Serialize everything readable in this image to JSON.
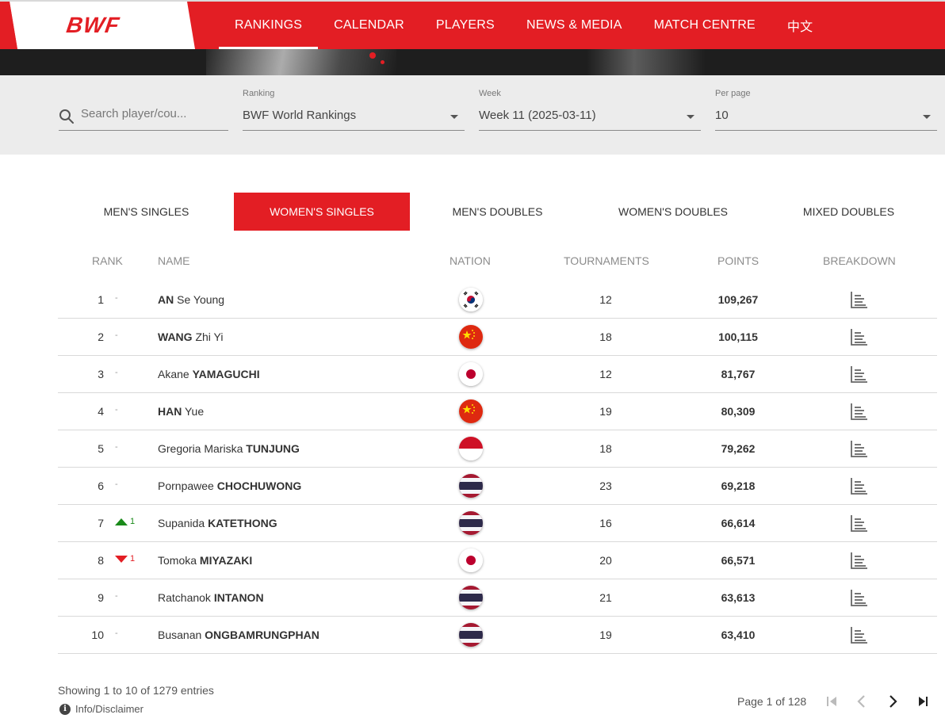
{
  "header": {
    "logo": "BWF",
    "nav": [
      {
        "label": "RANKINGS",
        "active": true
      },
      {
        "label": "CALENDAR",
        "active": false
      },
      {
        "label": "PLAYERS",
        "active": false
      },
      {
        "label": "NEWS & MEDIA",
        "active": false
      },
      {
        "label": "MATCH CENTRE",
        "active": false
      },
      {
        "label": "中文",
        "active": false
      }
    ]
  },
  "filters": {
    "search": {
      "placeholder": "Search player/cou..."
    },
    "ranking": {
      "label": "Ranking",
      "value": "BWF World Rankings"
    },
    "week": {
      "label": "Week",
      "value": "Week 11 (2025-03-11)"
    },
    "per_page": {
      "label": "Per page",
      "value": "10"
    }
  },
  "tabs": [
    {
      "label": "MEN'S SINGLES",
      "active": false
    },
    {
      "label": "WOMEN'S SINGLES",
      "active": true
    },
    {
      "label": "MEN'S DOUBLES",
      "active": false
    },
    {
      "label": "WOMEN'S DOUBLES",
      "active": false
    },
    {
      "label": "MIXED DOUBLES",
      "active": false
    }
  ],
  "table": {
    "headers": {
      "rank": "RANK",
      "name": "NAME",
      "nation": "NATION",
      "tournaments": "TOURNAMENTS",
      "points": "POINTS",
      "breakdown": "BREAKDOWN"
    },
    "rows": [
      {
        "rank": "1",
        "change": "-",
        "trend": "none",
        "first": "",
        "bold": "AN",
        "last": " Se Young",
        "nation": "KOR",
        "tournaments": "12",
        "points": "109,267"
      },
      {
        "rank": "2",
        "change": "-",
        "trend": "none",
        "first": "",
        "bold": "WANG",
        "last": " Zhi Yi",
        "nation": "CHN",
        "tournaments": "18",
        "points": "100,115"
      },
      {
        "rank": "3",
        "change": "-",
        "trend": "none",
        "first": "Akane ",
        "bold": "YAMAGUCHI",
        "last": "",
        "nation": "JPN",
        "tournaments": "12",
        "points": "81,767"
      },
      {
        "rank": "4",
        "change": "-",
        "trend": "none",
        "first": "",
        "bold": "HAN",
        "last": " Yue",
        "nation": "CHN",
        "tournaments": "19",
        "points": "80,309"
      },
      {
        "rank": "5",
        "change": "-",
        "trend": "none",
        "first": "Gregoria Mariska ",
        "bold": "TUNJUNG",
        "last": "",
        "nation": "INA",
        "tournaments": "18",
        "points": "79,262"
      },
      {
        "rank": "6",
        "change": "-",
        "trend": "none",
        "first": "Pornpawee ",
        "bold": "CHOCHUWONG",
        "last": "",
        "nation": "THA",
        "tournaments": "23",
        "points": "69,218"
      },
      {
        "rank": "7",
        "change": "1",
        "trend": "up",
        "first": "Supanida ",
        "bold": "KATETHONG",
        "last": "",
        "nation": "THA",
        "tournaments": "16",
        "points": "66,614"
      },
      {
        "rank": "8",
        "change": "1",
        "trend": "down",
        "first": "Tomoka ",
        "bold": "MIYAZAKI",
        "last": "",
        "nation": "JPN",
        "tournaments": "20",
        "points": "66,571"
      },
      {
        "rank": "9",
        "change": "-",
        "trend": "none",
        "first": "Ratchanok ",
        "bold": "INTANON",
        "last": "",
        "nation": "THA",
        "tournaments": "21",
        "points": "63,613"
      },
      {
        "rank": "10",
        "change": "-",
        "trend": "none",
        "first": "Busanan ",
        "bold": "ONGBAMRUNGPHAN",
        "last": "",
        "nation": "THA",
        "tournaments": "19",
        "points": "63,410"
      }
    ]
  },
  "footer": {
    "entries": "Showing 1 to 10 of 1279 entries",
    "info": "Info/Disclaimer",
    "page": "Page 1 of 128"
  },
  "colors": {
    "brand": "#e31e24",
    "up": "#1a8a1a",
    "down": "#e31e24"
  }
}
